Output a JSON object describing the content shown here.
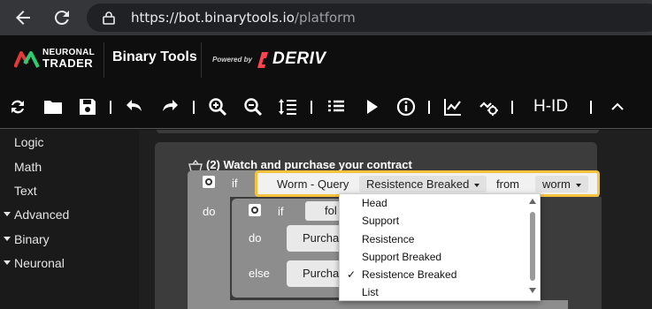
{
  "browser": {
    "url_host": "https://bot.binarytools.io",
    "url_path": "/platform",
    "back_icon": "arrow-left-icon",
    "reload_icon": "reload-icon",
    "lock_icon": "lock-icon"
  },
  "header": {
    "logo_line1": "NEURONAL",
    "logo_line2": "TRADER",
    "app_title": "Binary Tools",
    "powered_by": "Powered by",
    "deriv": "DERIV"
  },
  "toolbar": {
    "icons": [
      "refresh-icon",
      "folder-icon",
      "save-icon",
      "undo-icon",
      "redo-icon",
      "zoom-in-icon",
      "zoom-out-icon",
      "sort-icon",
      "list-icon",
      "play-icon",
      "info-icon",
      "chart-icon",
      "integrations-icon",
      "collapse-icon"
    ],
    "hid_label": "H-ID"
  },
  "sidebar": {
    "items": [
      {
        "label": "Logic",
        "expandable": false
      },
      {
        "label": "Math",
        "expandable": false
      },
      {
        "label": "Text",
        "expandable": false
      },
      {
        "label": "Advanced",
        "expandable": true
      },
      {
        "label": "Binary",
        "expandable": true
      },
      {
        "label": "Neuronal",
        "expandable": true
      }
    ]
  },
  "workspace": {
    "section_title": "(2) Watch and purchase your contract",
    "if_label": "if",
    "do_label": "do",
    "else_label": "else",
    "worm_label": "Worm - Query",
    "worm_selected": "Resistence Breaked",
    "from_label": "from",
    "from_value": "worm",
    "fol_value": "fol",
    "purchase_label": "Purcha",
    "purchase_else_label": "Purcha"
  },
  "dropdown": {
    "options": [
      {
        "label": "Head",
        "selected": false
      },
      {
        "label": "Support",
        "selected": false
      },
      {
        "label": "Resistence",
        "selected": false
      },
      {
        "label": "Support Breaked",
        "selected": false
      },
      {
        "label": "Resistence Breaked",
        "selected": true
      },
      {
        "label": "List",
        "selected": false
      }
    ],
    "check_mark": "✓"
  },
  "colors": {
    "accent_highlight": "#f6c23e",
    "deriv_red": "#ff444f",
    "logo_green": "#2ecc71",
    "logo_red": "#e53935"
  }
}
